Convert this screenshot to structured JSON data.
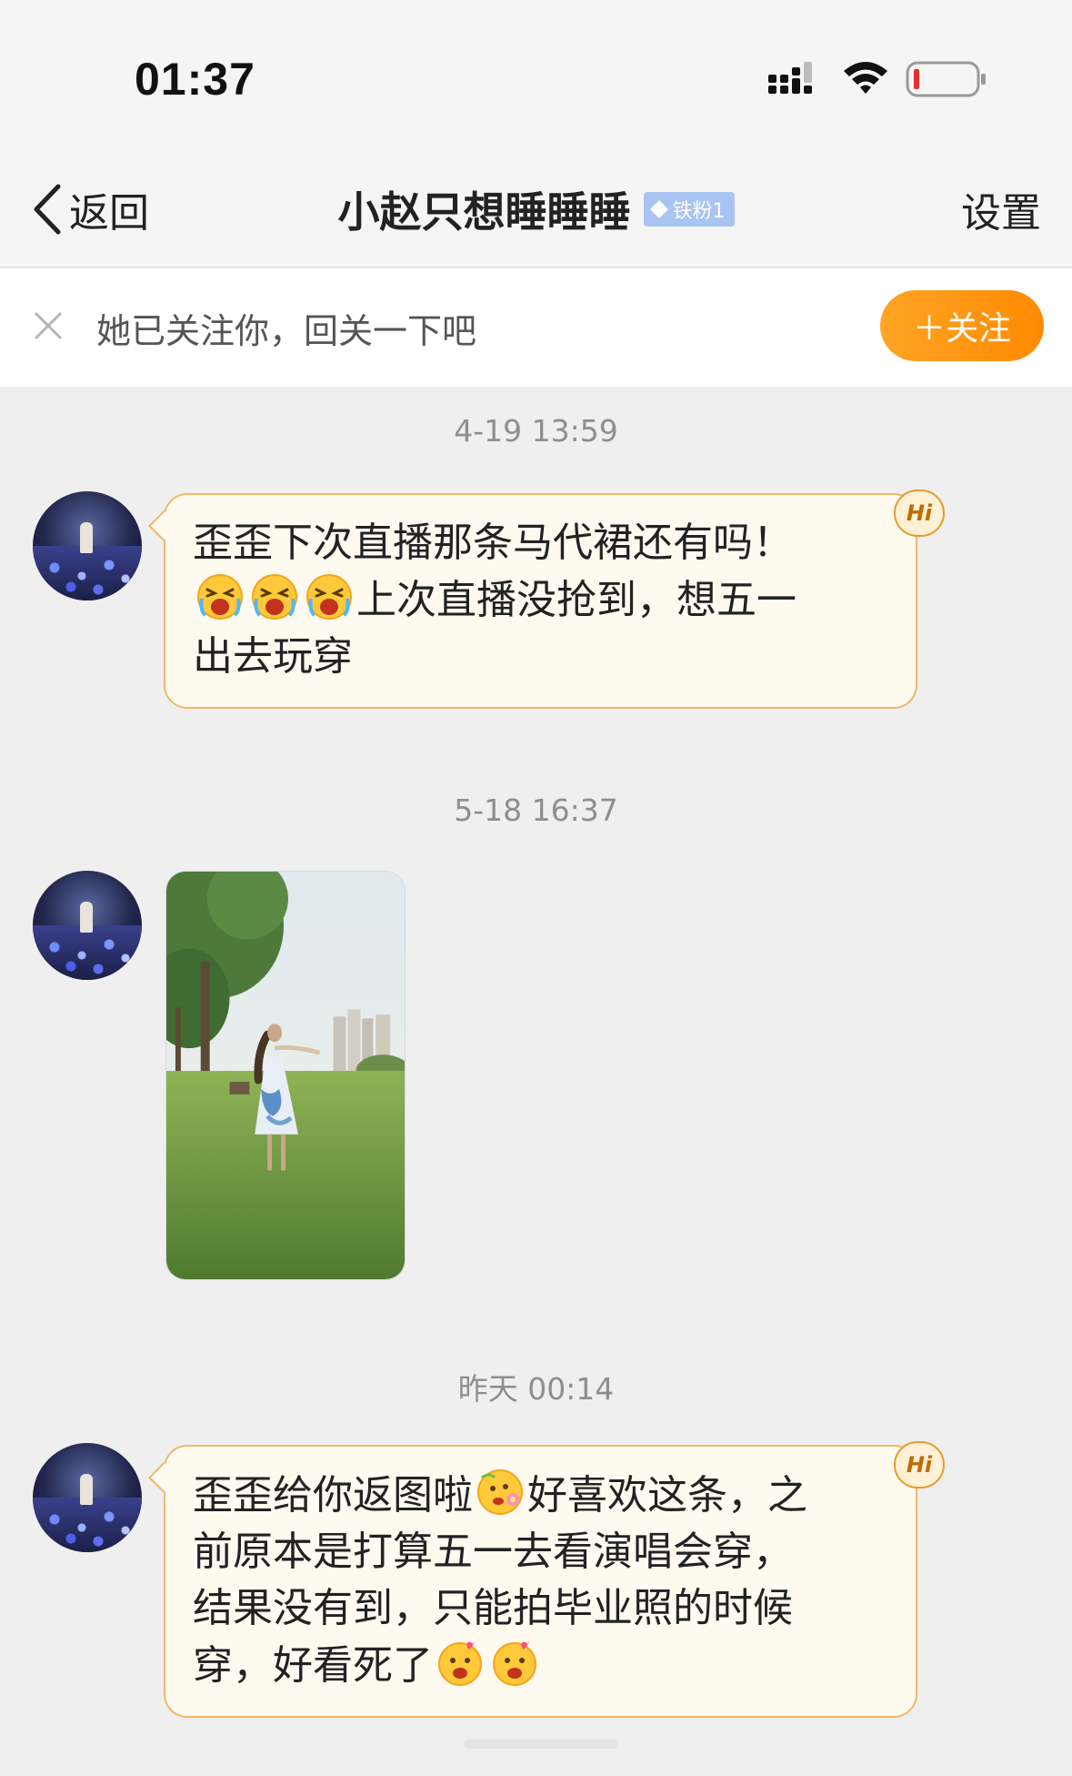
{
  "status_bar": {
    "time": "01:37"
  },
  "nav": {
    "back_label": "返回",
    "title": "小赵只想睡睡睡",
    "fan_badge": "铁粉1",
    "settings_label": "设置"
  },
  "follow_banner": {
    "hint": "她已关注你，回关一下吧",
    "button_label": "＋关注"
  },
  "messages": [
    {
      "timestamp": "4-19 13:59",
      "line1": "歪歪下次直播那条马代裙还有吗！",
      "line2_text": "上次直播没抢到，想五一",
      "line3": "出去玩穿",
      "badge": "Hi"
    },
    {
      "timestamp": "5-18 16:37",
      "type": "image"
    },
    {
      "timestamp": "昨天 00:14",
      "line1_a": "歪歪给你返图啦",
      "line1_b": "好喜欢这条，之",
      "line2": "前原本是打算五一去看演唱会穿，",
      "line3": "结果没有到，只能拍毕业照的时候",
      "line4": "穿，好看死了",
      "badge": "Hi"
    }
  ],
  "colors": {
    "accent_orange": "#ff8a00",
    "bubble_border": "#f0b86a",
    "bubble_bg": "#fffaf0",
    "badge_blue": "#a8c4f2"
  }
}
